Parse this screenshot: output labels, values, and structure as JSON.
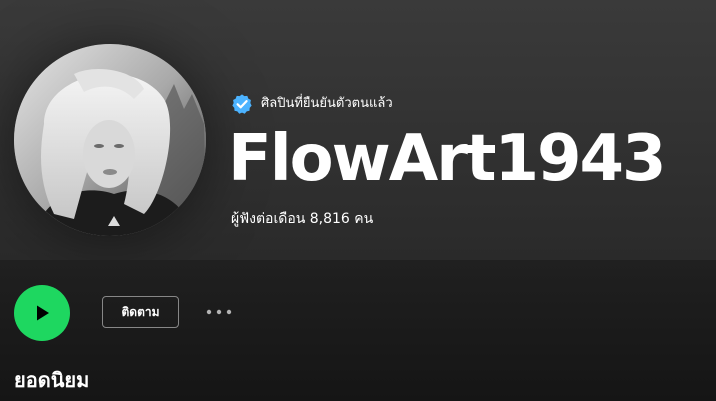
{
  "header": {
    "verified_label": "ศิลปินที่ยืนยันตัวตนแล้ว",
    "artist_name": "FlowArt1943",
    "monthly_listeners": "ผู้ฟังต่อเดือน 8,816 คน"
  },
  "actions": {
    "follow_label": "ติดตาม",
    "more_icon": "more-horizontal-icon",
    "play_icon": "play-icon"
  },
  "sections": {
    "popular_title": "ยอดนิยม"
  },
  "colors": {
    "accent_green": "#1ed760",
    "verified_blue": "#4cb3ff",
    "background": "#121212"
  }
}
